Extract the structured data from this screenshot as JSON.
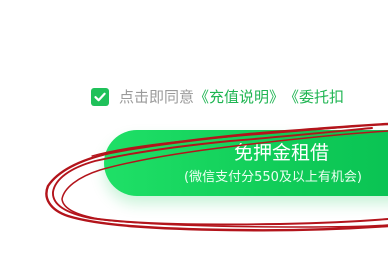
{
  "agreement": {
    "checked": true,
    "prefix": "点击即同意",
    "links": [
      "《充值说明》",
      "《委托扣"
    ]
  },
  "cta": {
    "title": "免押金租借",
    "subtitle": "(微信支付分550及以上有机会)"
  },
  "colors": {
    "accent": "#1fc15a",
    "button_start": "#1fe067",
    "button_end": "#08c052",
    "muted_text": "#9a9a9a",
    "annotation": "#b3141b"
  },
  "icons": {
    "checkbox": "check-icon"
  }
}
